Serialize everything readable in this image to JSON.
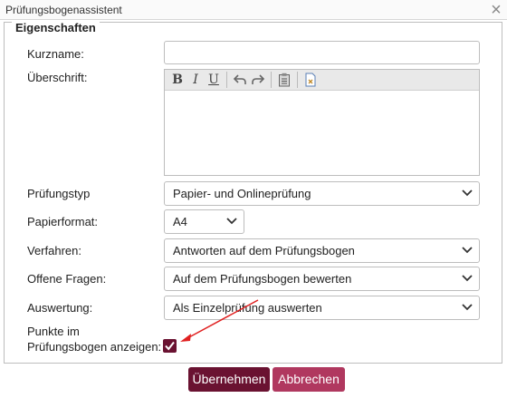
{
  "window": {
    "title": "Prüfungsbogenassistent",
    "close_icon": "close-icon"
  },
  "fieldset": {
    "legend": "Eigenschaften"
  },
  "form": {
    "kurzname": {
      "label": "Kurzname:",
      "value": ""
    },
    "ueberschrift": {
      "label": "Überschrift:",
      "toolbar": {
        "bold": "B",
        "italic": "I",
        "underline": "U",
        "icons": [
          "undo-icon",
          "redo-icon",
          "paste-icon",
          "source-icon"
        ]
      }
    },
    "pruefungstyp": {
      "label": "Prüfungstyp",
      "value": "Papier- und Onlineprüfung"
    },
    "papierformat": {
      "label": "Papierformat:",
      "value": "A4"
    },
    "verfahren": {
      "label": "Verfahren:",
      "value": "Antworten auf dem Prüfungsbogen"
    },
    "offene_fragen": {
      "label": "Offene Fragen:",
      "value": "Auf dem Prüfungsbogen bewerten"
    },
    "auswertung": {
      "label": "Auswertung:",
      "value": "Als Einzelprüfung auswerten"
    },
    "punkte": {
      "label_line1": "Punkte im",
      "label_line2": "Prüfungsbogen anzeigen:",
      "checked": true
    }
  },
  "buttons": {
    "apply": "Übernehmen",
    "cancel": "Abbrechen"
  },
  "colors": {
    "primary": "#6a1231",
    "secondary": "#b0385f",
    "annotation_arrow": "#e02020"
  }
}
